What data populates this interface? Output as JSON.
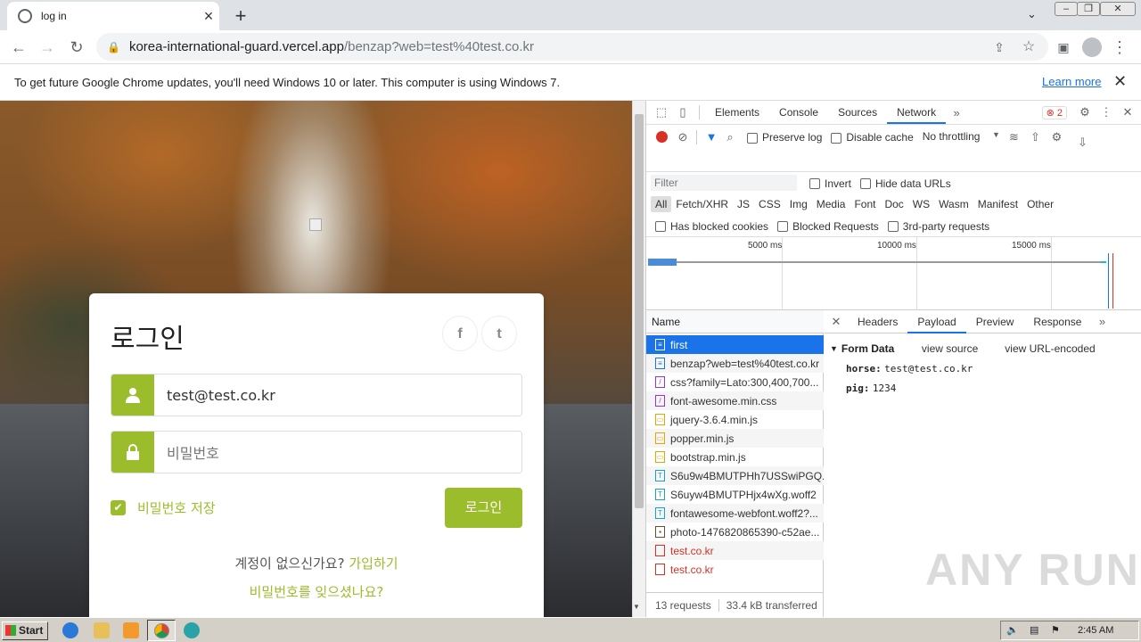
{
  "browser": {
    "tab_title": "log in",
    "url_host": "korea-international-guard.vercel.app",
    "url_path": "/benzap?web=test%40test.co.kr"
  },
  "infobar": {
    "message": "To get future Google Chrome updates, you'll need Windows 10 or later. This computer is using Windows 7.",
    "learn_more": "Learn more"
  },
  "login": {
    "title": "로그인",
    "email_value": "test@test.co.kr",
    "password_placeholder": "비밀번호",
    "remember_label": "비밀번호 저장",
    "login_button": "로그인",
    "no_account": "계정이 없으신가요?",
    "signup_link": "가입하기",
    "forgot_link": "비밀번호를 잊으셨나요?",
    "social": [
      "f",
      "t"
    ]
  },
  "devtools": {
    "tabs": [
      "Elements",
      "Console",
      "Sources",
      "Network"
    ],
    "active_tab": "Network",
    "error_count": "2",
    "preserve_log": "Preserve log",
    "disable_cache": "Disable cache",
    "throttling": "No throttling",
    "filter_placeholder": "Filter",
    "invert": "Invert",
    "hide_data_urls": "Hide data URLs",
    "filter_types": [
      "All",
      "Fetch/XHR",
      "JS",
      "CSS",
      "Img",
      "Media",
      "Font",
      "Doc",
      "WS",
      "Wasm",
      "Manifest",
      "Other"
    ],
    "has_blocked_cookies": "Has blocked cookies",
    "blocked_requests": "Blocked Requests",
    "third_party": "3rd-party requests",
    "timeline_ticks": [
      "5000 ms",
      "10000 ms",
      "15000 ms"
    ],
    "name_header": "Name",
    "requests": [
      {
        "name": "first",
        "type": "doc",
        "status": "selected"
      },
      {
        "name": "benzap?web=test%40test.co.kr",
        "type": "doc",
        "status": "ok"
      },
      {
        "name": "css?family=Lato:300,400,700...",
        "type": "css",
        "status": "ok"
      },
      {
        "name": "font-awesome.min.css",
        "type": "css",
        "status": "ok"
      },
      {
        "name": "jquery-3.6.4.min.js",
        "type": "js",
        "status": "ok"
      },
      {
        "name": "popper.min.js",
        "type": "js",
        "status": "ok"
      },
      {
        "name": "bootstrap.min.js",
        "type": "js",
        "status": "ok"
      },
      {
        "name": "S6u9w4BMUTPHh7USSwiPGQ...",
        "type": "font",
        "status": "ok"
      },
      {
        "name": "S6uyw4BMUTPHjx4wXg.woff2",
        "type": "font",
        "status": "ok"
      },
      {
        "name": "fontawesome-webfont.woff2?...",
        "type": "font",
        "status": "ok"
      },
      {
        "name": "photo-1476820865390-c52ae...",
        "type": "img",
        "status": "ok"
      },
      {
        "name": "test.co.kr",
        "type": "other",
        "status": "error"
      },
      {
        "name": "test.co.kr",
        "type": "other",
        "status": "error"
      }
    ],
    "footer_requests": "13 requests",
    "footer_transferred": "33.4 kB transferred",
    "detail_tabs": [
      "Headers",
      "Payload",
      "Preview",
      "Response"
    ],
    "active_detail_tab": "Payload",
    "form_data_title": "Form Data",
    "view_source": "view source",
    "view_url_encoded": "view URL-encoded",
    "form_fields": [
      {
        "key": "horse:",
        "value": "test@test.co.kr"
      },
      {
        "key": "pig:",
        "value": "1234"
      }
    ]
  },
  "taskbar": {
    "start": "Start",
    "clock": "2:45 AM"
  },
  "watermark": "ANY RUN",
  "colors": {
    "accent_green": "#9bbd2b",
    "devtools_blue": "#1a73e8",
    "error_red": "#d93025"
  }
}
